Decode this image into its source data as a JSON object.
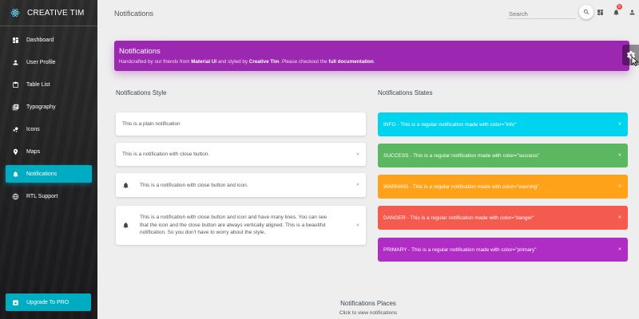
{
  "brand": {
    "name": "CREATIVE TIM",
    "logo_icon": "react-atom-icon"
  },
  "sidebar": {
    "items": [
      {
        "label": "Dashboard",
        "icon": "dashboard-icon",
        "active": false
      },
      {
        "label": "User Profile",
        "icon": "person-icon",
        "active": false
      },
      {
        "label": "Table List",
        "icon": "clipboard-icon",
        "active": false
      },
      {
        "label": "Typography",
        "icon": "library-books-icon",
        "active": false
      },
      {
        "label": "Icons",
        "icon": "bubble-chart-icon",
        "active": false
      },
      {
        "label": "Maps",
        "icon": "location-pin-icon",
        "active": false
      },
      {
        "label": "Notifications",
        "icon": "bell-icon",
        "active": true
      },
      {
        "label": "RTL Support",
        "icon": "language-icon",
        "active": false
      }
    ],
    "upgrade_label": "Upgrade To PRO",
    "active_color": "#00acc1"
  },
  "topbar": {
    "title": "Notifications",
    "search_placeholder": "Search",
    "notification_count": "5"
  },
  "header": {
    "title": "Notifications",
    "sub_prefix": "Handcrafted by our friends from ",
    "sub_link1": "Material UI",
    "sub_middle": " and styled by ",
    "sub_link2": "Creative Tim",
    "sub_after": ". Please checkout the ",
    "sub_link3": "full documentation",
    "sub_end": ".",
    "color": "#9c27b0"
  },
  "styles": {
    "title": "Notifications Style",
    "plain": "This is a plain notification",
    "with_close": "This is a notification with close button.",
    "with_icon": "This is a notification with close button and icon.",
    "multi_line": "This is a notification with close button and icon and have many lines. You can see that the icon and the close button are always vertically aligned. This is a beautiful notification. So you don't have to worry about the style.",
    "close": "×"
  },
  "states": {
    "title": "Notifications States",
    "items": [
      {
        "text": "INFO - This is a regular notification made with color=\"info\"",
        "color": "#00d3ee"
      },
      {
        "text": "SUCCESS - This is a regular notification made with color=\"success\"",
        "color": "#5cb860"
      },
      {
        "text": "WARNING - This is a regular notification made with color=\"warning\"",
        "color": "#ffa21a"
      },
      {
        "text": "DANGER - This is a regular notification made with color=\"danger\"",
        "color": "#f55a4e"
      },
      {
        "text": "PRIMARY - This is a regular notification made with color=\"primary\"",
        "color": "#af2cc5"
      }
    ],
    "close": "×"
  },
  "places": {
    "title": "Notifications Places",
    "subtitle": "Click to view notifications"
  }
}
